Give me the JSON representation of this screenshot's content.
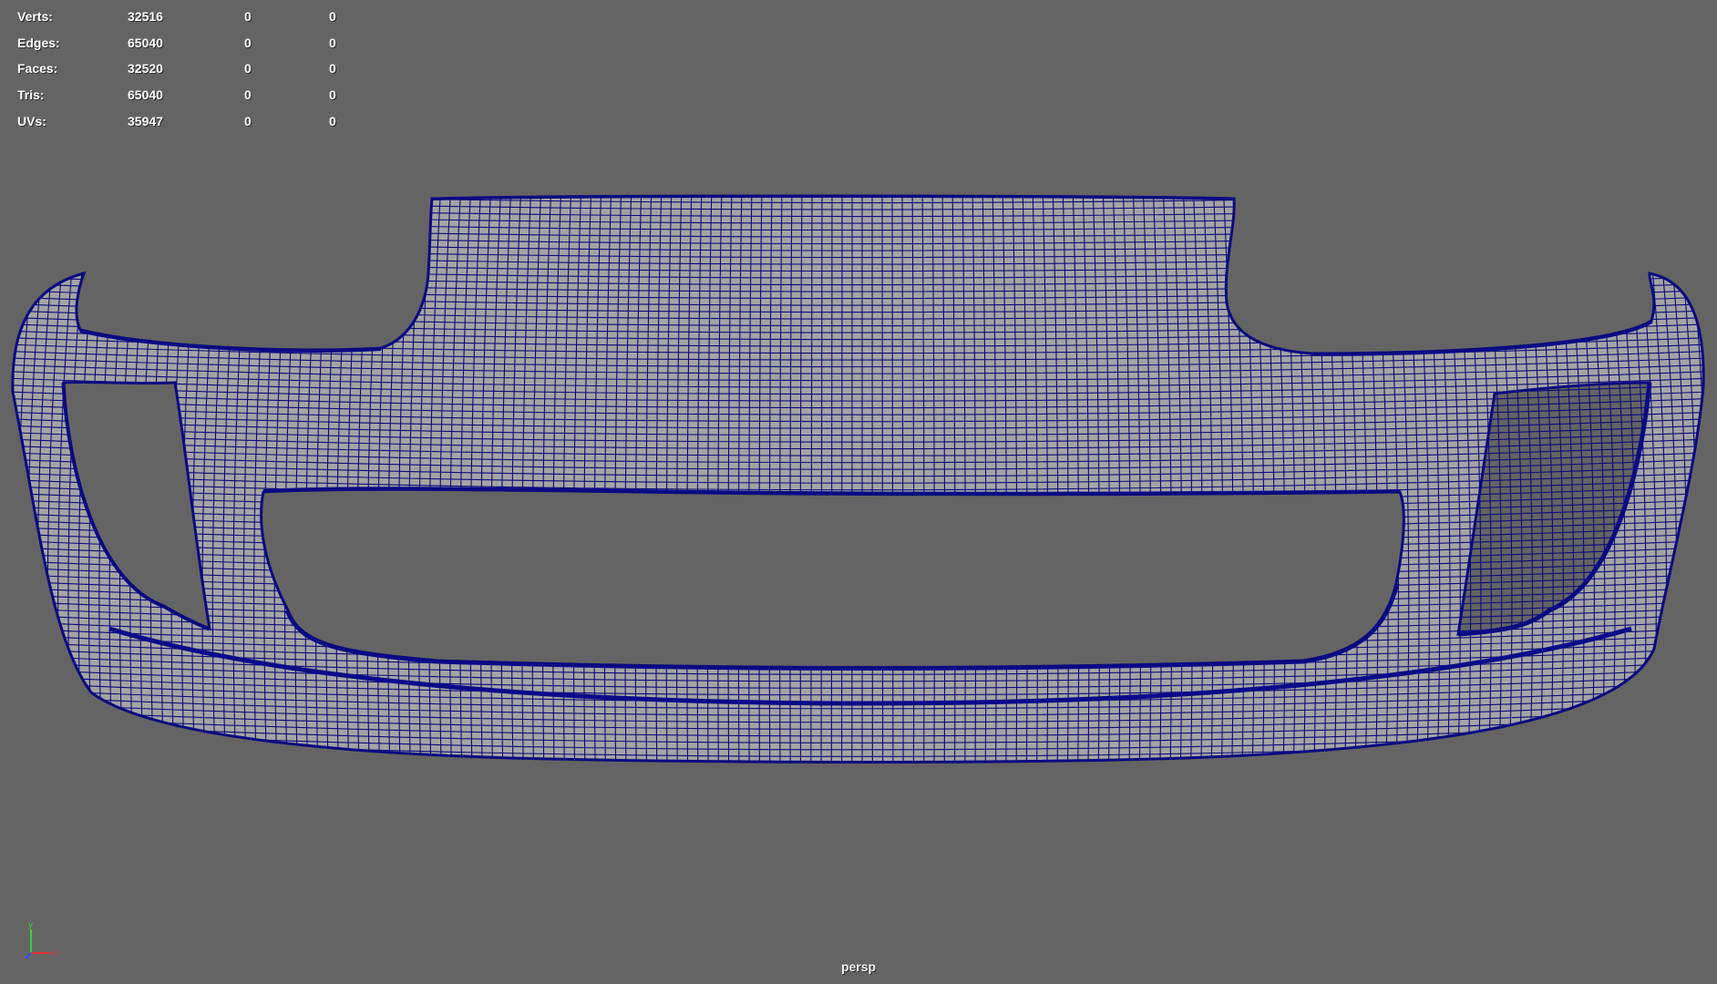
{
  "heads_up": {
    "rows": [
      {
        "label": "Verts:",
        "value": "32516",
        "selected": "0",
        "extra": "0"
      },
      {
        "label": "Edges:",
        "value": "65040",
        "selected": "0",
        "extra": "0"
      },
      {
        "label": "Faces:",
        "value": "32520",
        "selected": "0",
        "extra": "0"
      },
      {
        "label": "Tris:",
        "value": "65040",
        "selected": "0",
        "extra": "0"
      },
      {
        "label": "UVs:",
        "value": "35947",
        "selected": "0",
        "extra": "0"
      }
    ]
  },
  "viewport": {
    "camera": "persp",
    "background_color": "#646464",
    "wire_color": "#0a0a7a",
    "surface_color": "#a4a4a4"
  },
  "axis_gizmo": {
    "y_label": "y",
    "x_label": "x"
  }
}
